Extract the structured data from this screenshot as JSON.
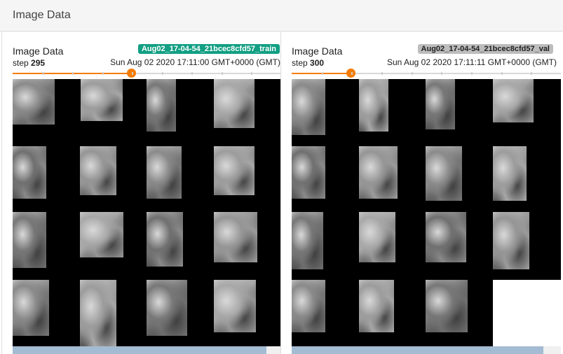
{
  "section": {
    "title": "Image Data"
  },
  "cards": [
    {
      "title": "Image Data",
      "run": "Aug02_17-04-54_21bcec8cfd57_train",
      "run_color": "#129f83",
      "step_prefix": "step",
      "step": "295",
      "timestamp": "Sun Aug 02 2020 17:11:00 GMT+0000 (GMT)",
      "slider_position": 0.44,
      "scroll_fraction": 0.945
    },
    {
      "title": "Image Data",
      "run": "Aug02_17-04-54_21bcec8cfd57_val",
      "run_color": "#bdbdbd",
      "step_prefix": "step",
      "step": "300",
      "timestamp": "Sun Aug 02 2020 17:11:11 GMT+0000 (GMT)",
      "slider_position": 0.22,
      "scroll_fraction": 0.935
    }
  ],
  "colors": {
    "accent": "#f57c00",
    "train": "#129f83",
    "val": "#bdbdbd"
  }
}
